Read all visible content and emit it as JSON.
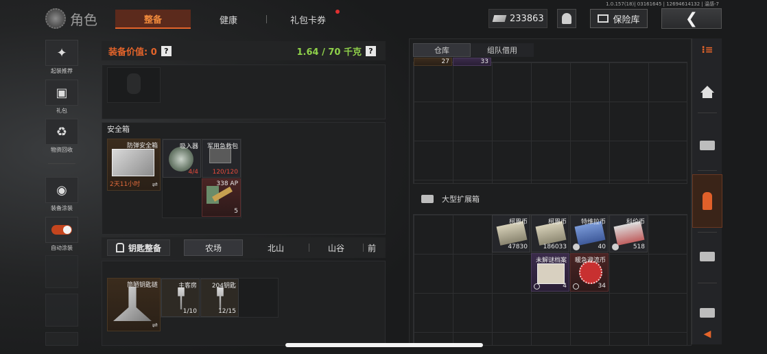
{
  "version": "1.0.157(18)| 03161645 | 12694614132 | 温感-7",
  "header": {
    "title": "角色",
    "tabs": [
      "整备",
      "健康",
      "礼包卡券"
    ],
    "money": "233863",
    "vault_label": "保险库",
    "back_glyph": "❮"
  },
  "sidebar": {
    "items": [
      {
        "label": "起装推荐",
        "icon": "gun-icon"
      },
      {
        "label": "礼包",
        "icon": "gift-icon"
      },
      {
        "label": "物资回收",
        "icon": "recycle-icon"
      },
      {
        "label": "装备涂装",
        "icon": "helmet-icon"
      },
      {
        "label": "自动涂装",
        "icon": "toggle-icon"
      }
    ]
  },
  "equipment": {
    "value_label": "装备价值: 0",
    "weight_label": "1.64 / 70 千克",
    "help": "?"
  },
  "safe_box": {
    "title": "安全箱",
    "items": [
      {
        "name": "防弹安全箱",
        "timer": "2天11小时",
        "swap": "⇌"
      },
      {
        "name": "吸入器",
        "count": "4/4"
      },
      {
        "name": "军用急救包",
        "count": "120/120"
      },
      {
        "name": "338 AP",
        "count": "5"
      }
    ]
  },
  "keys": {
    "button": "钥匙整备",
    "maps": [
      "农场",
      "北山",
      "山谷",
      "前"
    ],
    "items": [
      {
        "name": "简陋钥匙链",
        "swap": "⇌"
      },
      {
        "name": "主客房",
        "count": "1/10"
      },
      {
        "name": "204钥匙",
        "count": "12/15"
      }
    ]
  },
  "storage": {
    "tabs": [
      "仓库",
      "组队借用"
    ],
    "top_counts": [
      "27",
      "33"
    ],
    "expansion_title": "大型扩展箱",
    "items": [
      {
        "name": "柯恩币",
        "count": "47830"
      },
      {
        "name": "柯恩币",
        "count": "186033"
      },
      {
        "name": "特维拉币",
        "count": "40"
      },
      {
        "name": "科伦币",
        "count": "518"
      },
      {
        "name": "未解谜档案",
        "count": "4"
      },
      {
        "name": "暖急避流币",
        "count": "34"
      }
    ]
  },
  "colors": {
    "accent": "#e4642a",
    "weight_ok": "#8fd14a",
    "count_full": "#e94b3c"
  }
}
